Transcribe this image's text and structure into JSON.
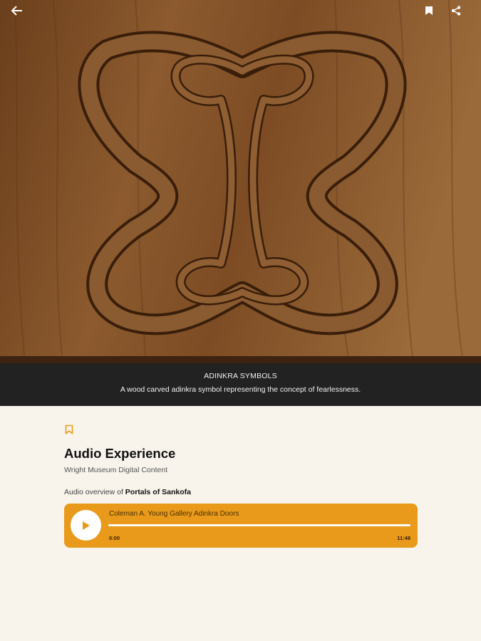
{
  "hero": {
    "back_icon": "arrow-left-icon",
    "bookmark_icon": "bookmark-icon",
    "share_icon": "share-icon",
    "image_subject": "wood-carved-adinkra-symbol"
  },
  "caption": {
    "title": "ADINKRA SYMBOLS",
    "text": "A wood carved adinkra symbol representing the concept of fearlessness."
  },
  "main": {
    "bookmark_icon": "bookmark-outline-icon",
    "title": "Audio Experience",
    "subtitle": "Wright Museum Digital Content",
    "overview_prefix": "Audio overview of ",
    "overview_link": "Portals of Sankofa"
  },
  "player": {
    "track_title": "Coleman A. Young Gallery Adinkra Doors",
    "current_time": "0:00",
    "total_time": "11:48",
    "progress": 0,
    "play_icon": "play-icon",
    "accent_color": "#e99a1a"
  }
}
